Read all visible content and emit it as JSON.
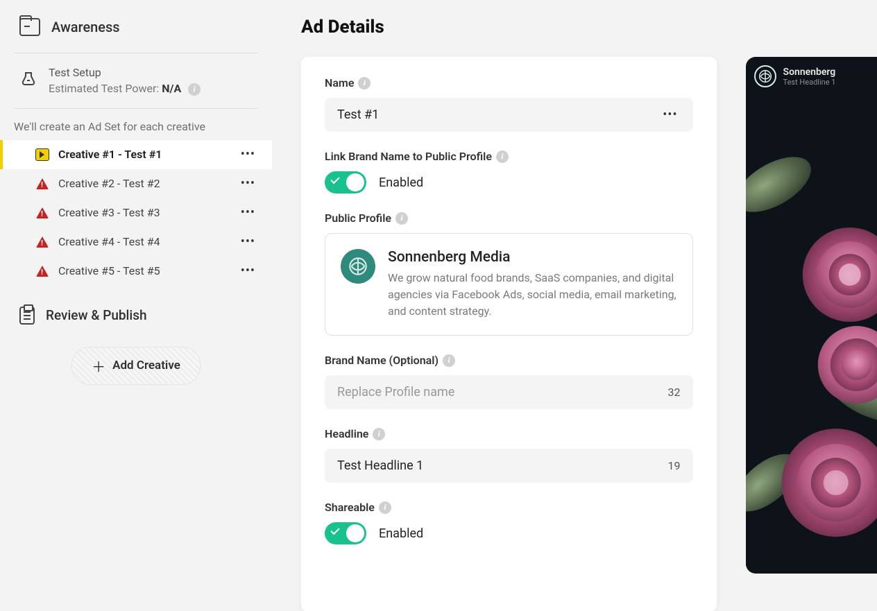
{
  "sidebar": {
    "title": "Awareness",
    "test_setup": {
      "title": "Test Setup",
      "power_label": "Estimated Test Power: ",
      "power_value": "N/A"
    },
    "adset_note": "We'll create an Ad Set for each creative",
    "creatives": [
      {
        "label": "Creative #1 - Test #1",
        "icon": "play",
        "active": true
      },
      {
        "label": "Creative #2 - Test #2",
        "icon": "warn",
        "active": false
      },
      {
        "label": "Creative #3 - Test #3",
        "icon": "warn",
        "active": false
      },
      {
        "label": "Creative #4 - Test #4",
        "icon": "warn",
        "active": false
      },
      {
        "label": "Creative #5 - Test #5",
        "icon": "warn",
        "active": false
      }
    ],
    "review_publish": "Review & Publish",
    "add_creative": "Add Creative"
  },
  "main": {
    "title": "Ad Details",
    "name": {
      "label": "Name",
      "value": "Test #1"
    },
    "link_brand": {
      "label": "Link Brand Name to Public Profile",
      "enabled_text": "Enabled"
    },
    "public_profile": {
      "label": "Public Profile",
      "name": "Sonnenberg Media",
      "desc": "We grow natural food brands, SaaS companies, and digital agencies via Facebook Ads, social media, email marketing, and content strategy."
    },
    "brand_name": {
      "label": "Brand Name (Optional)",
      "placeholder": "Replace Profile name",
      "counter": "32"
    },
    "headline": {
      "label": "Headline",
      "value": "Test Headline 1",
      "counter": "19"
    },
    "shareable": {
      "label": "Shareable",
      "enabled_text": "Enabled"
    }
  },
  "preview": {
    "brand": "Sonnenberg",
    "sub": "Test Headline 1"
  },
  "colors": {
    "accent": "#18c18e",
    "warning": "#c62222",
    "highlight": "#f2d000"
  }
}
